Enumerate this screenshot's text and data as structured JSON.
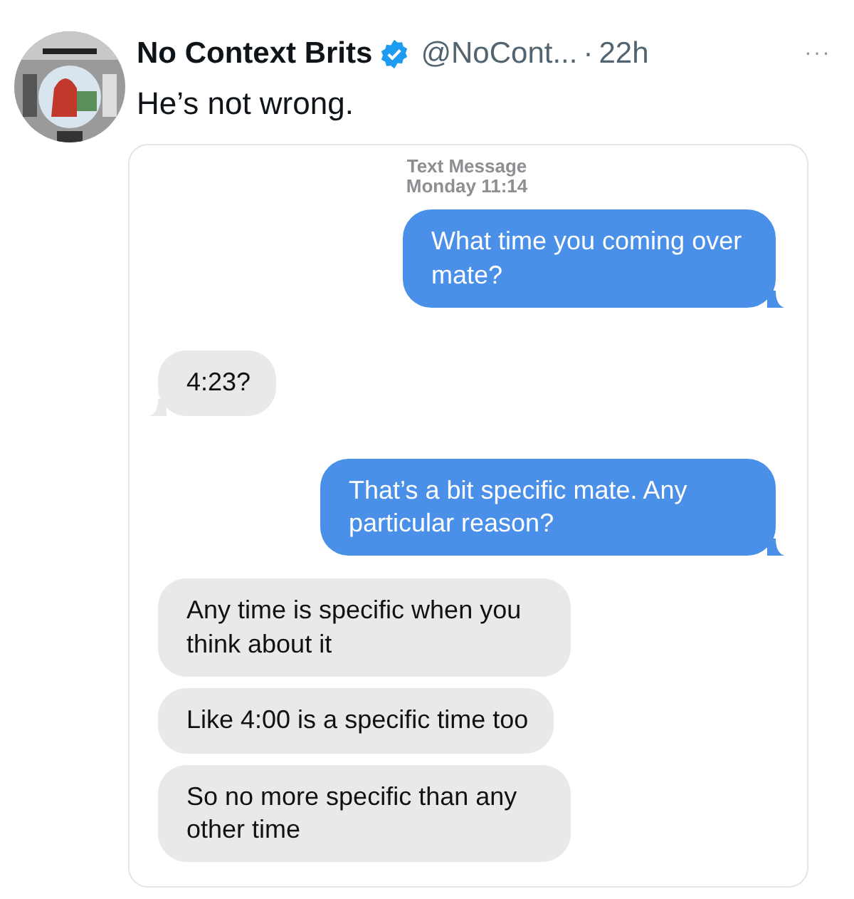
{
  "tweet": {
    "author": "No Context Brits",
    "verified": true,
    "handle": "@NoCont...",
    "separator": "·",
    "time": "22h",
    "more": "···",
    "text": "He’s not wrong."
  },
  "conversation": {
    "header": "Text Message",
    "timestamp": "Monday 11:14",
    "messages": [
      {
        "kind": "sent",
        "text": "What time you coming over mate?",
        "tail": true
      },
      {
        "kind": "received",
        "text": "4:23?",
        "tail": true
      },
      {
        "kind": "sent",
        "text": "That’s a bit specific mate. Any particular reason?",
        "tail": true
      },
      {
        "kind": "received",
        "text": "Any time is specific when you think about it",
        "tail": false
      },
      {
        "kind": "received",
        "text": "Like 4:00 is a specific time too",
        "tail": false
      },
      {
        "kind": "received",
        "text": "So no more specific than any other time",
        "tail": false
      }
    ]
  }
}
